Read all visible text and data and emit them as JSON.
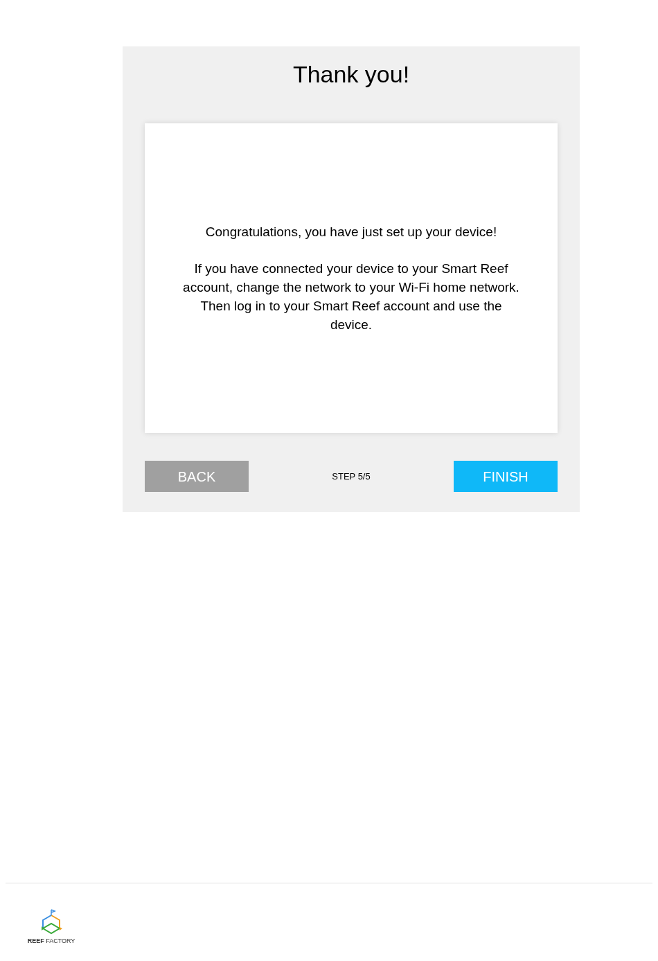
{
  "dialog": {
    "title": "Thank you!",
    "paragraphs": [
      "Congratulations, you have just set up your device!",
      "If you have connected your device to your Smart Reef account, change the network to your Wi-Fi home network. Then log in to your Smart Reef account and use the device."
    ],
    "back_button": "BACK",
    "step": "STEP 5/5",
    "finish_button": "FINISH"
  },
  "footer": {
    "logo_text": "**REEF** FACTORY"
  }
}
